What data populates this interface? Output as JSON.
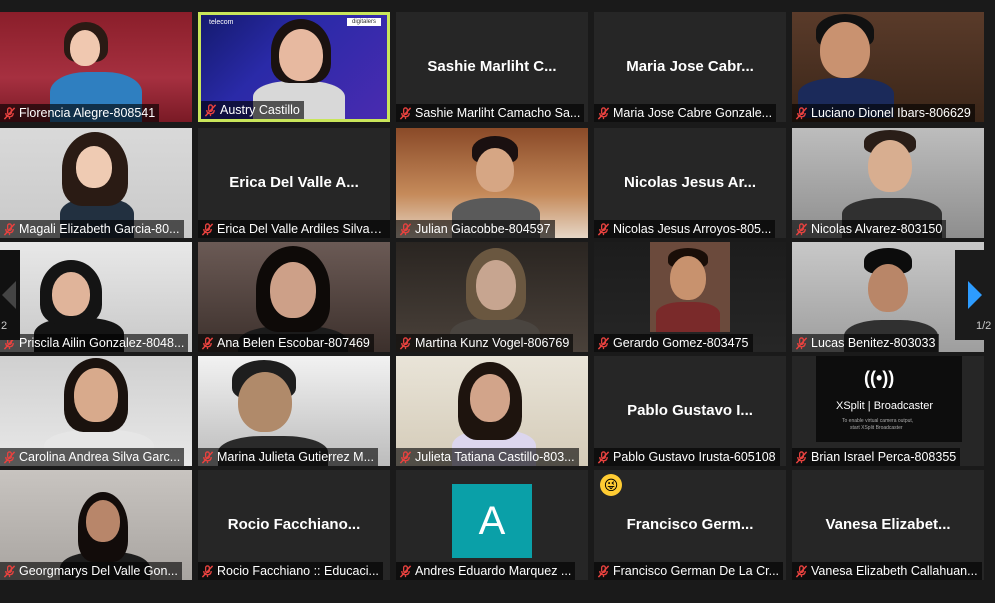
{
  "participants": [
    {
      "label": "Florencia Alegre-808541",
      "bigname": ""
    },
    {
      "label": "Austry Castillo",
      "bigname": ""
    },
    {
      "label": "Sashie Marliht Camacho Sa...",
      "bigname": "Sashie  Marliht  C..."
    },
    {
      "label": "Maria Jose Cabre Gonzale...",
      "bigname": "Maria Jose  Cabr..."
    },
    {
      "label": "Luciano Dionel Ibars-806629",
      "bigname": ""
    },
    {
      "label": "Magali Elizabeth Garcia-80...",
      "bigname": ""
    },
    {
      "label": "Erica Del Valle Ardiles Silva-80...",
      "bigname": "Erica  Del Valle  A..."
    },
    {
      "label": "Julian Giacobbe-804597",
      "bigname": ""
    },
    {
      "label": "Nicolas Jesus Arroyos-805...",
      "bigname": "Nicolas  Jesus  Ar..."
    },
    {
      "label": "Nicolas Alvarez-803150",
      "bigname": ""
    },
    {
      "label": "Priscila Ailin Gonzalez-8048...",
      "bigname": ""
    },
    {
      "label": "Ana Belen Escobar-807469",
      "bigname": ""
    },
    {
      "label": "Martina Kunz Vogel-806769",
      "bigname": ""
    },
    {
      "label": "Gerardo Gomez-803475",
      "bigname": ""
    },
    {
      "label": "Lucas Benitez-803033",
      "bigname": ""
    },
    {
      "label": "Carolina Andrea Silva Garc...",
      "bigname": ""
    },
    {
      "label": "Marina Julieta Gutierrez M...",
      "bigname": ""
    },
    {
      "label": "Julieta Tatiana Castillo-803...",
      "bigname": ""
    },
    {
      "label": "Pablo Gustavo Irusta-605108",
      "bigname": "Pablo  Gustavo  I..."
    },
    {
      "label": "Brian Israel Perca-808355",
      "bigname": ""
    },
    {
      "label": "Georgmarys Del Valle Gon...",
      "bigname": ""
    },
    {
      "label": "Rocio Facchiano :: Educaci...",
      "bigname": "Rocio  Facchiano..."
    },
    {
      "label": "Andres Eduardo Marquez ...",
      "bigname": ""
    },
    {
      "label": "Francisco German De La Cr...",
      "bigname": "Francisco  Germ..."
    },
    {
      "label": "Vanesa Elizabeth Callahuan...",
      "bigname": "Vanesa  Elizabet..."
    }
  ],
  "avatar_letter": "A",
  "page_left": "2",
  "page_right": "1/2",
  "active_speaker_color": "#c9e65a",
  "mic_muted_color": "#e8423f",
  "icons": {
    "mic": "mic-muted-icon",
    "next": "chevron-right-icon",
    "prev": "chevron-left-icon"
  },
  "xsplit": {
    "logo": "XSplit | Broadcaster",
    "hint1": "To enable virtual camera output,",
    "hint2": "start XSplit Broadcaster"
  },
  "banner": {
    "left": "telecom",
    "right": "digitalers"
  }
}
